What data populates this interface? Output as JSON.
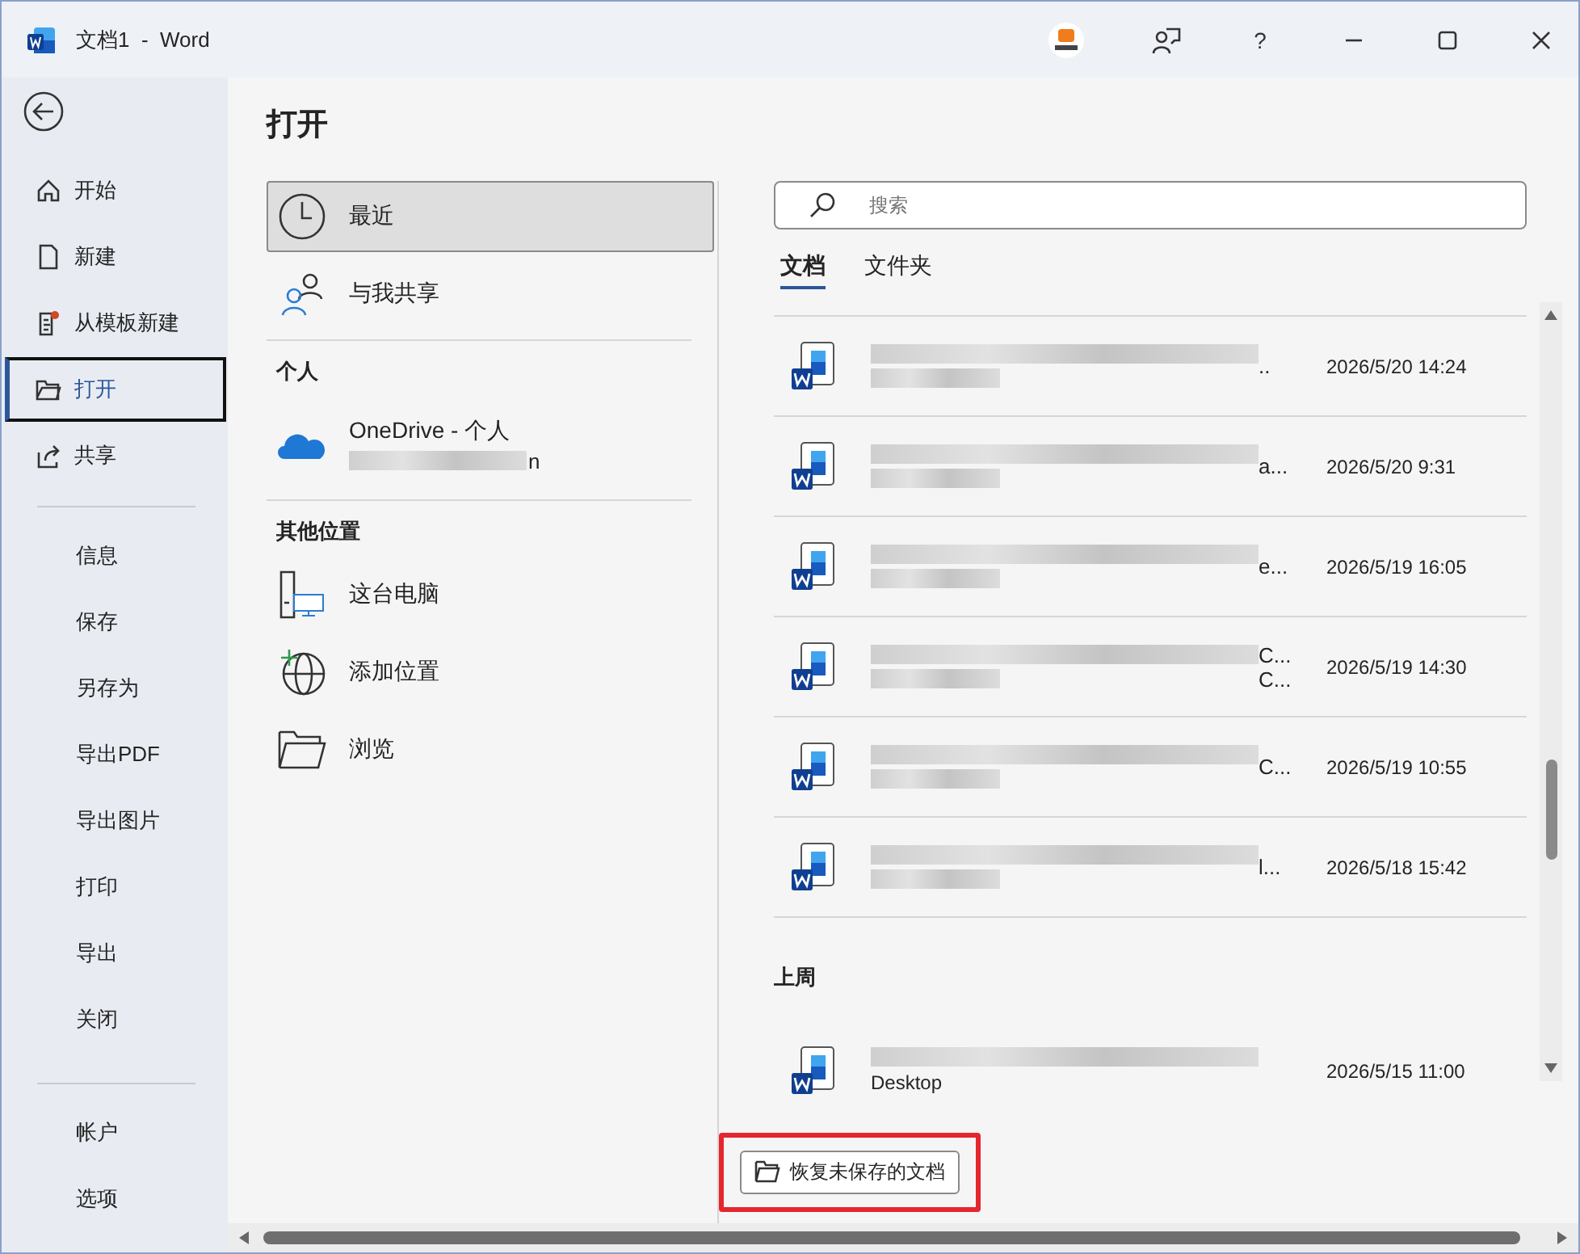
{
  "window": {
    "title": "文档1  -  Word",
    "help": "?"
  },
  "sidebar": {
    "top": [
      {
        "label": "开始",
        "kind": "home",
        "selected": false
      },
      {
        "label": "新建",
        "kind": "page",
        "selected": false
      },
      {
        "label": "从模板新建",
        "kind": "template",
        "selected": false
      },
      {
        "label": "打开",
        "kind": "folder",
        "selected": true
      },
      {
        "label": "共享",
        "kind": "share",
        "selected": false
      }
    ],
    "middle": [
      "信息",
      "保存",
      "另存为",
      "导出PDF",
      "导出图片",
      "打印",
      "导出",
      "关闭"
    ],
    "bottom": [
      "帐户",
      "选项"
    ]
  },
  "page_title": "打开",
  "places": [
    {
      "label": "最近",
      "kind": "clock",
      "selected": true
    },
    {
      "label": "与我共享",
      "kind": "people",
      "selected": false
    }
  ],
  "sections": [
    {
      "heading": "个人",
      "items": [
        {
          "label": "OneDrive - 个人",
          "kind": "cloud",
          "sublabel_tail": "n"
        }
      ]
    },
    {
      "heading": "其他位置",
      "items": [
        {
          "label": "这台电脑",
          "kind": "pc"
        },
        {
          "label": "添加位置",
          "kind": "globe"
        },
        {
          "label": "浏览",
          "kind": "folder"
        }
      ]
    }
  ],
  "search": {
    "placeholder": "搜索"
  },
  "tabs": [
    {
      "label": "文档",
      "selected": true
    },
    {
      "label": "文件夹",
      "selected": false
    }
  ],
  "groups": [
    {
      "files": [
        {
          "tails": [
            ".."
          ],
          "time": "2026/5/20 14:24"
        },
        {
          "tails": [
            "a..."
          ],
          "time": "2026/5/20 9:31"
        },
        {
          "tails": [
            "e..."
          ],
          "time": "2026/5/19 16:05"
        },
        {
          "tails": [
            "C...",
            "C..."
          ],
          "time": "2026/5/19 14:30"
        },
        {
          "tails": [
            "C..."
          ],
          "time": "2026/5/19 10:55"
        },
        {
          "tails": [
            "l..."
          ],
          "time": "2026/5/18 15:42"
        }
      ]
    },
    {
      "heading": "上周",
      "files": [
        {
          "location": "Desktop",
          "time": "2026/5/15 11:00"
        }
      ]
    }
  ],
  "recover_button": {
    "label": "恢复未保存的文档",
    "highlighted": true
  }
}
